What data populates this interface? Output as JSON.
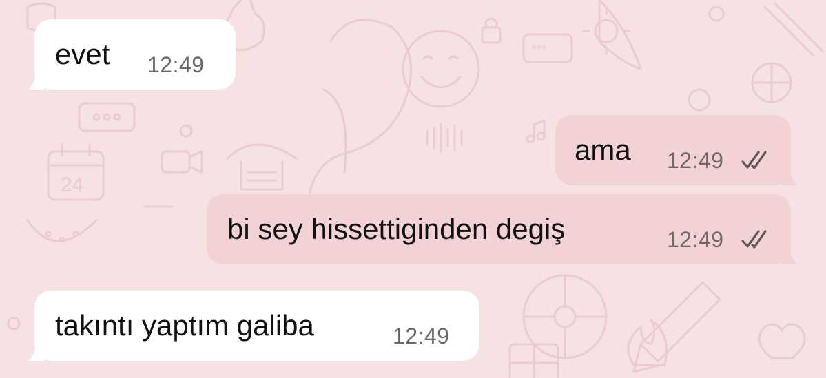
{
  "chat": {
    "messages": [
      {
        "direction": "incoming",
        "text": "evet",
        "time": "12:49"
      },
      {
        "direction": "outgoing",
        "text": "ama",
        "time": "12:49",
        "status": "read-double-check-icon"
      },
      {
        "direction": "outgoing",
        "text": "bi sey hissettiginden degiş",
        "time": "12:49",
        "status": "read-double-check-icon"
      },
      {
        "direction": "incoming",
        "text": "takıntı yaptım galiba",
        "time": "12:49"
      }
    ]
  },
  "colors": {
    "wallpaper": "#f6e1e3",
    "doodle": "#eccbd0",
    "incoming_bubble": "#ffffff",
    "outgoing_bubble": "#f3d2d6",
    "timestamp": "#6f6567"
  }
}
